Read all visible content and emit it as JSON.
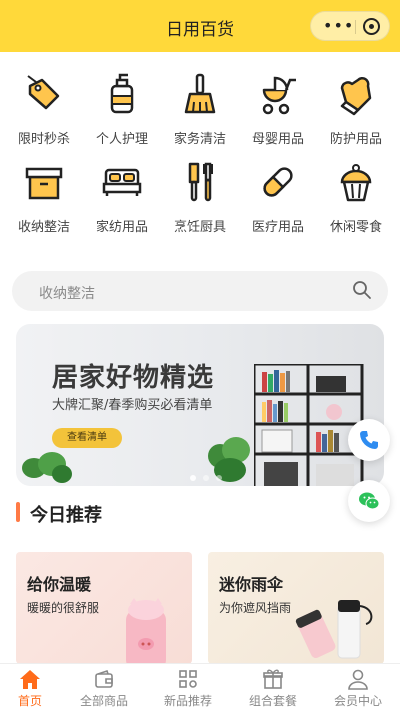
{
  "header": {
    "title": "日用百货"
  },
  "categories": [
    {
      "label": "限时秒杀",
      "icon": "price-tag-icon"
    },
    {
      "label": "个人护理",
      "icon": "lotion-bottle-icon"
    },
    {
      "label": "家务清洁",
      "icon": "broom-icon"
    },
    {
      "label": "母婴用品",
      "icon": "stroller-icon"
    },
    {
      "label": "防护用品",
      "icon": "glove-icon"
    },
    {
      "label": "收纳整洁",
      "icon": "storage-box-icon"
    },
    {
      "label": "家纺用品",
      "icon": "bed-icon"
    },
    {
      "label": "烹饪厨具",
      "icon": "kitchen-utensils-icon"
    },
    {
      "label": "医疗用品",
      "icon": "pill-icon"
    },
    {
      "label": "休闲零食",
      "icon": "cupcake-icon"
    }
  ],
  "search": {
    "placeholder": "收纳整洁"
  },
  "banner": {
    "headline": "居家好物精选",
    "subline": "大牌汇聚/春季购买必看清单",
    "button": "查看清单",
    "slide_count": 3,
    "active_slide": 1
  },
  "section": {
    "title": "今日推荐"
  },
  "promos": [
    {
      "title": "给你温暖",
      "subtitle": "暖暖的很舒服"
    },
    {
      "title": "迷你雨伞",
      "subtitle": "为你遮风挡雨"
    }
  ],
  "tabs": [
    {
      "label": "首页",
      "icon": "home-icon",
      "active": true
    },
    {
      "label": "全部商品",
      "icon": "wallet-icon",
      "active": false
    },
    {
      "label": "新品推荐",
      "icon": "grid-icon",
      "active": false
    },
    {
      "label": "组合套餐",
      "icon": "gift-icon",
      "active": false
    },
    {
      "label": "会员中心",
      "icon": "user-icon",
      "active": false
    }
  ],
  "colors": {
    "header": "#ffd93a",
    "accent": "#ff6b1a",
    "icon_fill": "#ffc54d"
  }
}
